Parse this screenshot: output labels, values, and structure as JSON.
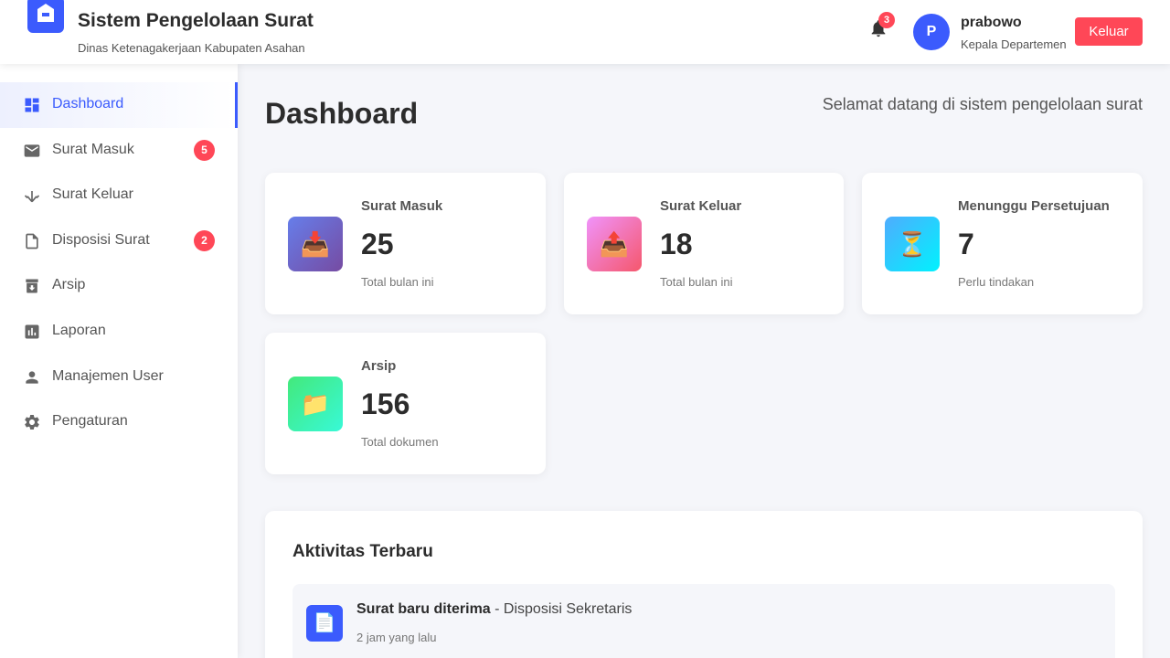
{
  "header": {
    "title": "Sistem Pengelolaan Surat",
    "subtitle": "Dinas Ketenagakerjaan Kabupaten Asahan",
    "notification_count": "3",
    "user": {
      "initial": "P",
      "name": "prabowo",
      "role": "Kepala Departemen"
    },
    "logout_label": "Keluar"
  },
  "sidebar": {
    "items": [
      {
        "label": "Dashboard",
        "icon": "dashboard-icon",
        "active": true
      },
      {
        "label": "Surat Masuk",
        "icon": "mail-icon",
        "badge": "5"
      },
      {
        "label": "Surat Keluar",
        "icon": "send-icon"
      },
      {
        "label": "Disposisi Surat",
        "icon": "document-icon",
        "badge": "2"
      },
      {
        "label": "Arsip",
        "icon": "archive-icon"
      },
      {
        "label": "Laporan",
        "icon": "report-icon"
      },
      {
        "label": "Manajemen User",
        "icon": "user-icon"
      },
      {
        "label": "Pengaturan",
        "icon": "gear-icon"
      }
    ]
  },
  "main": {
    "title": "Dashboard",
    "welcome": "Selamat datang di sistem pengelolaan surat",
    "cards": [
      {
        "label": "Surat Masuk",
        "value": "25",
        "note": "Total bulan ini",
        "icon": "📥",
        "icon_name": "inbox-tray-icon"
      },
      {
        "label": "Surat Keluar",
        "value": "18",
        "note": "Total bulan ini",
        "icon": "📤",
        "icon_name": "outbox-tray-icon"
      },
      {
        "label": "Menunggu Persetujuan",
        "value": "7",
        "note": "Perlu tindakan",
        "icon": "⏳",
        "icon_name": "hourglass-icon"
      },
      {
        "label": "Arsip",
        "value": "156",
        "note": "Total dokumen",
        "icon": "📁",
        "icon_name": "folder-icon"
      }
    ],
    "activity": {
      "title": "Aktivitas Terbaru",
      "items": [
        {
          "title": "Surat baru diterima",
          "detail": " - Disposisi Sekretaris",
          "time": "2 jam yang lalu",
          "icon": "📄",
          "icon_name": "page-icon"
        }
      ]
    }
  },
  "colors": {
    "primary": "#3b5bfd",
    "danger": "#ff4757",
    "card_gradients": [
      "#667eea-#764ba2",
      "#f093fb-#f5576c",
      "#4facfe-#00f2fe",
      "#43e97b-#38f9d7"
    ]
  }
}
